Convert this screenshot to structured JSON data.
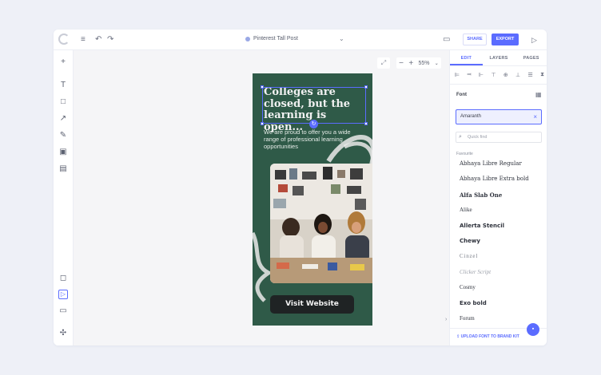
{
  "topbar": {
    "menu_icon": "hamburger-icon",
    "undo_icon": "undo-icon",
    "redo_icon": "redo-icon",
    "doc_title": "Pinterest Tall Post",
    "comment_icon": "comment-icon",
    "share_label": "SHARE",
    "export_label": "EXPORT",
    "play_icon": "play-icon"
  },
  "left_tools": [
    "plus-icon",
    "text-icon",
    "shape-icon",
    "line-icon",
    "pen-icon",
    "image-icon",
    "table-icon",
    "crop-icon",
    "select-icon",
    "keyboard-icon",
    "settings-icon"
  ],
  "canvas": {
    "zoom": "55%",
    "poster": {
      "headline": "Colleges are closed, but the learning is open...",
      "subtext": "We are proud to offer you a wide range of professional learning opportunities",
      "cta_label": "Visit Website",
      "background_color": "#2f5a48"
    }
  },
  "panel": {
    "tabs": [
      {
        "label": "EDIT",
        "active": true
      },
      {
        "label": "LAYERS",
        "active": false
      },
      {
        "label": "PAGES",
        "active": false
      }
    ],
    "font_label": "Font",
    "font_value": "Amaranth",
    "quick_find_placeholder": "Quick find",
    "favourite_label": "Favourite",
    "fonts": [
      "Abhaya Libre Regular",
      "Abhaya Libre Extra bold",
      "Alfa Slab One",
      "Alike",
      "Allerta Stencil",
      "Chewy",
      "Cinzel",
      "Clicker Script",
      "Cosmy",
      "Exo bold",
      "Forum"
    ],
    "upload_label": "UPLOAD FONT TO BRAND KIT"
  },
  "colors": {
    "accent": "#5b6cff",
    "poster_green": "#2f5a48"
  }
}
